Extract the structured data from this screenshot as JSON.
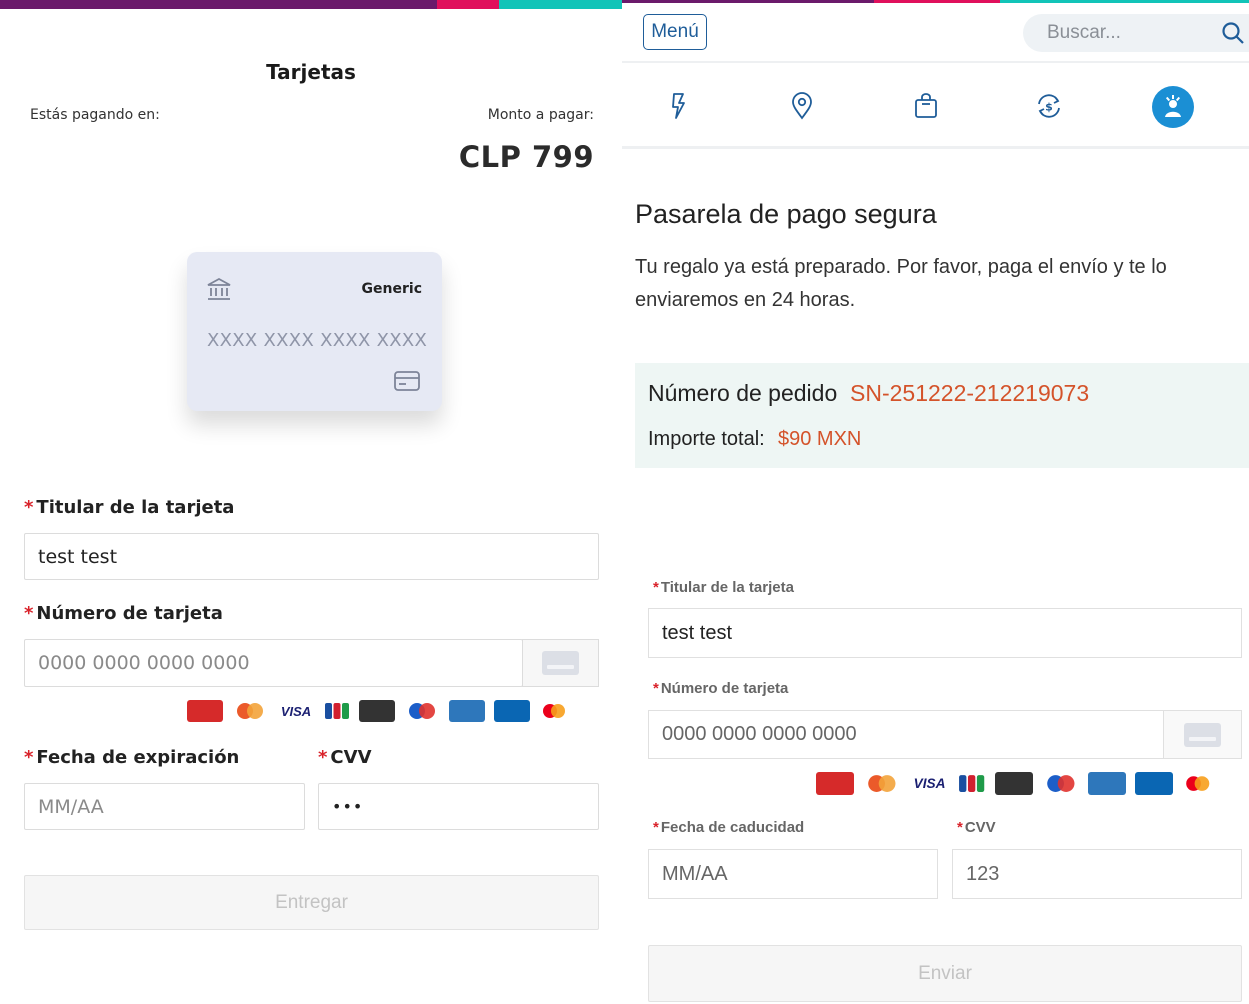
{
  "left": {
    "title": "Tarjetas",
    "paying_label": "Estás pagando en:",
    "amount_label": "Monto a pagar:",
    "amount": "CLP 799",
    "card_preview": {
      "brand": "Generic",
      "number": "XXXX XXXX XXXX XXXX"
    },
    "holder": {
      "required_mark": "*",
      "label": "Titular de la tarjeta",
      "value": "test test"
    },
    "card_number": {
      "required_mark": "*",
      "label": "Número de tarjeta",
      "placeholder": "0000 0000 0000 0000"
    },
    "expiry": {
      "required_mark": "*",
      "label": "Fecha de expiración",
      "placeholder": "MM/AA"
    },
    "cvv": {
      "required_mark": "*",
      "label": "CVV",
      "value": "•••"
    },
    "submit_label": "Entregar"
  },
  "right": {
    "menu_label": "Menú",
    "search_placeholder": "Buscar...",
    "nav_icons": [
      "lightning-icon",
      "location-pin-icon",
      "shopping-bag-icon",
      "currency-exchange-icon",
      "gift-person-icon"
    ],
    "title": "Pasarela de pago segura",
    "description": "Tu regalo ya está preparado. Por favor, paga el envío y te lo enviaremos en 24 horas.",
    "order_label": "Número de pedido",
    "order_number": "SN-251222-212219073",
    "total_label": "Importe total:",
    "total_value": "$90 MXN",
    "holder": {
      "required_mark": "*",
      "label": "Titular de la tarjeta",
      "value": "test test"
    },
    "card_number": {
      "required_mark": "*",
      "label": "Número de tarjeta",
      "placeholder": "0000 0000 0000 0000"
    },
    "expiry": {
      "required_mark": "*",
      "label": "Fecha de caducidad",
      "placeholder": "MM/AA"
    },
    "cvv": {
      "required_mark": "*",
      "label": "CVV",
      "placeholder": "123"
    },
    "submit_label": "Enviar"
  },
  "card_logos": [
    {
      "name": "unionpay-logo",
      "color": "#d62a2a"
    },
    {
      "name": "mastercard-logo",
      "color": "#eb5a2a"
    },
    {
      "name": "visa-logo",
      "color": "#1a1f71",
      "text": "VISA"
    },
    {
      "name": "jcb-logo",
      "color": "#1a4fa0"
    },
    {
      "name": "discover-logo",
      "color": "#333333"
    },
    {
      "name": "maestro-logo",
      "color": "#1c5ec8"
    },
    {
      "name": "amex-logo",
      "color": "#2e77bb"
    },
    {
      "name": "diners-logo",
      "color": "#0a66b3"
    },
    {
      "name": "mastercard-logo-2",
      "color": "#eb001b"
    }
  ],
  "colors": {
    "purple_stripe": "#6b1a6b",
    "pink_stripe": "#e0105c",
    "teal_stripe": "#12c4b8",
    "link_blue": "#1f5d99",
    "order_orange": "#d4532a",
    "required_red": "#d9222a"
  }
}
